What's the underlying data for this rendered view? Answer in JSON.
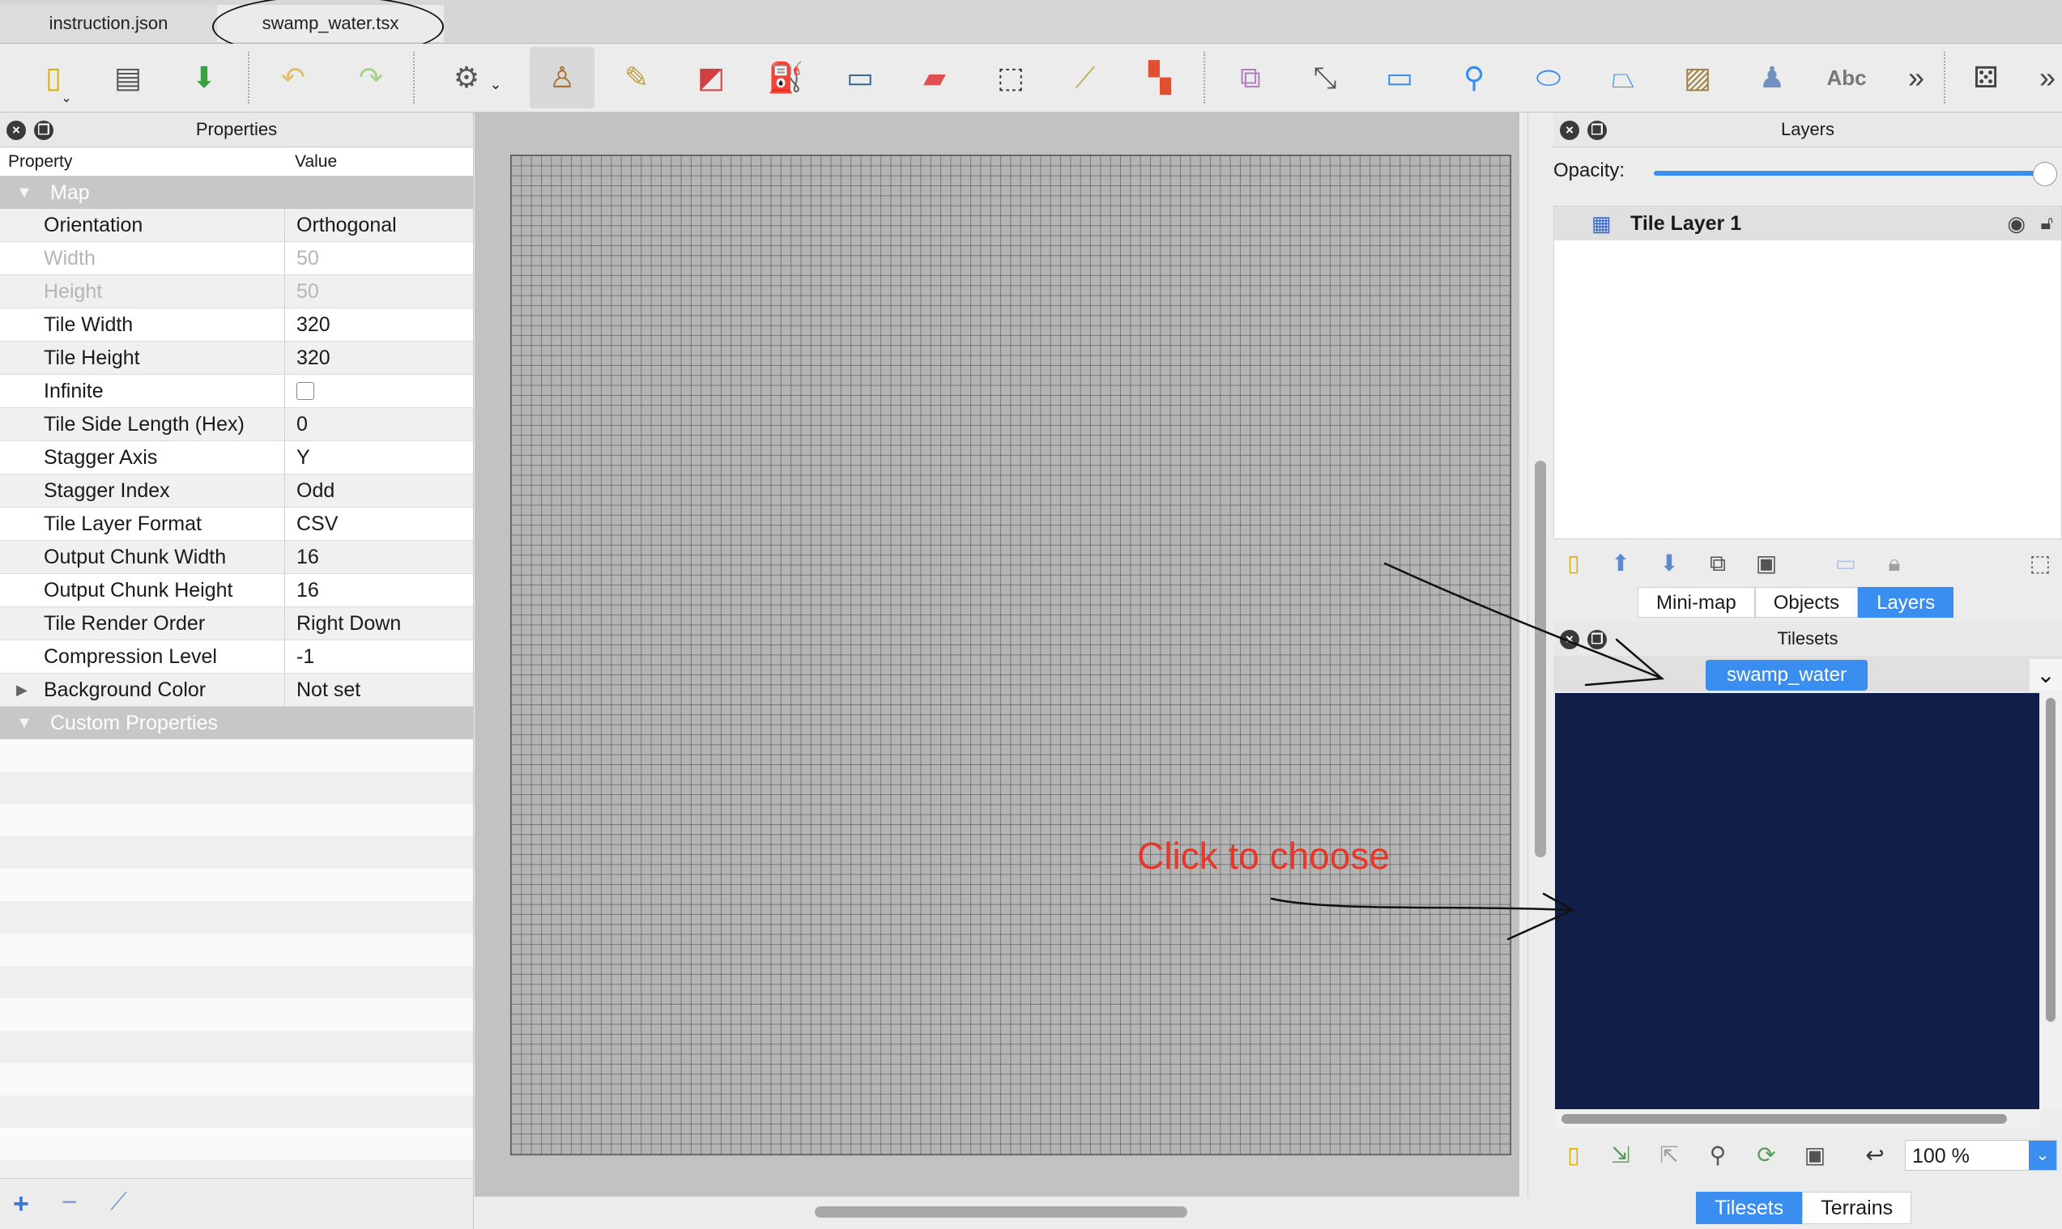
{
  "tabs": [
    {
      "label": "instruction.json"
    },
    {
      "label": "swamp_water.tsx"
    }
  ],
  "toolbar": {
    "icons": [
      "new-icon",
      "open-icon",
      "save-icon",
      "undo-icon",
      "redo-icon",
      "commands-icon",
      "stamp-brush-icon",
      "terrain-brush-icon",
      "wang-brush-icon",
      "bucket-fill-icon",
      "shape-fill-icon",
      "eraser-icon",
      "rectangular-select-icon",
      "magic-wand-icon",
      "select-same-tile-icon",
      "select-objects-icon",
      "edit-polygons-icon",
      "insert-rectangle-icon",
      "insert-point-icon",
      "insert-ellipse-icon",
      "insert-polygon-icon",
      "insert-tile-icon",
      "insert-template-icon",
      "insert-text-icon",
      "more-icon",
      "random-mode-icon",
      "overflow-icon"
    ]
  },
  "properties": {
    "title": "Properties",
    "col_property": "Property",
    "col_value": "Value",
    "group_map": "Map",
    "rows": [
      {
        "name": "Orientation",
        "value": "Orthogonal"
      },
      {
        "name": "Width",
        "value": "50"
      },
      {
        "name": "Height",
        "value": "50"
      },
      {
        "name": "Tile Width",
        "value": "320"
      },
      {
        "name": "Tile Height",
        "value": "320"
      },
      {
        "name": "Infinite",
        "value": ""
      },
      {
        "name": "Tile Side Length (Hex)",
        "value": "0"
      },
      {
        "name": "Stagger Axis",
        "value": "Y"
      },
      {
        "name": "Stagger Index",
        "value": "Odd"
      },
      {
        "name": "Tile Layer Format",
        "value": "CSV"
      },
      {
        "name": "Output Chunk Width",
        "value": "16"
      },
      {
        "name": "Output Chunk Height",
        "value": "16"
      },
      {
        "name": "Tile Render Order",
        "value": "Right Down"
      },
      {
        "name": "Compression Level",
        "value": "-1"
      },
      {
        "name": "Background Color",
        "value": "Not set"
      }
    ],
    "group_custom": "Custom Properties"
  },
  "layers": {
    "title": "Layers",
    "opacity_label": "Opacity:",
    "opacity": 1.0,
    "layer_name": "Tile Layer 1",
    "tabs": [
      "Mini-map",
      "Objects",
      "Layers"
    ],
    "active_tab": "Layers"
  },
  "tilesets": {
    "title": "Tilesets",
    "active_tileset": "swamp_water",
    "zoom": "100 %",
    "tabs": [
      "Tilesets",
      "Terrains"
    ],
    "active_tab": "Tilesets"
  },
  "annotation": {
    "text": "Click to choose",
    "color": "#e5382a"
  },
  "colors": {
    "accent": "#3a8ef0",
    "tileset_bg": "#0f1f47"
  }
}
